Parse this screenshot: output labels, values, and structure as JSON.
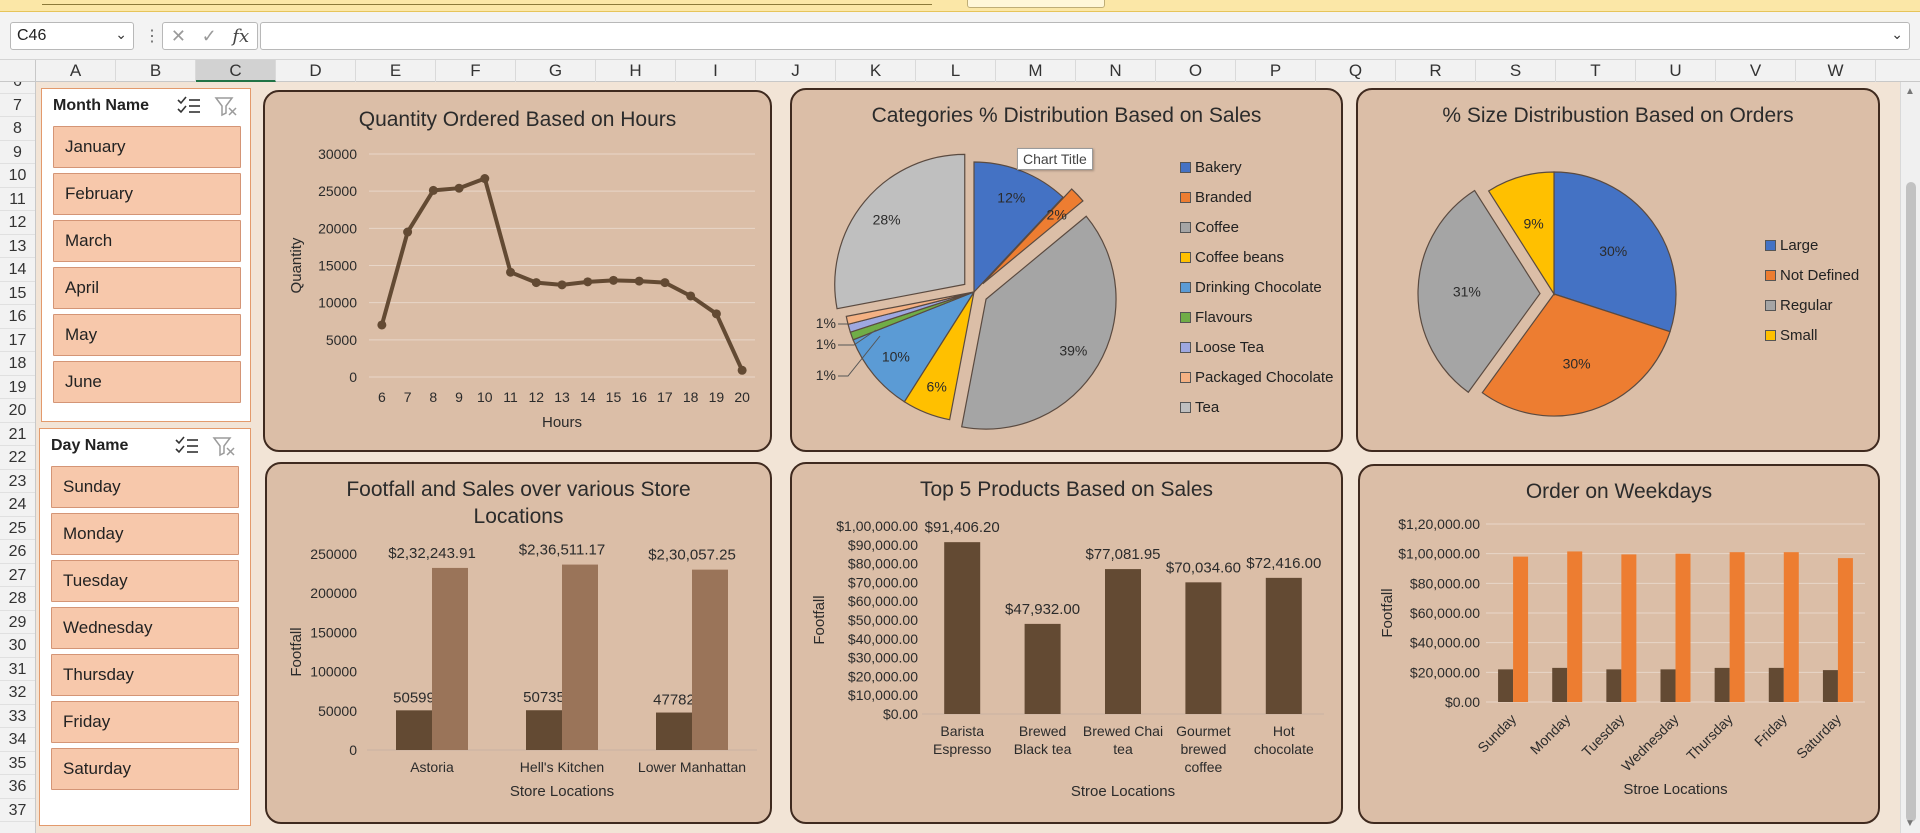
{
  "formula_bar": {
    "name_box": "C46",
    "dots": "⋮",
    "cancel": "✕",
    "enter": "✓",
    "fx": "fx",
    "content": ""
  },
  "columns": [
    "A",
    "B",
    "C",
    "D",
    "E",
    "F",
    "G",
    "H",
    "I",
    "J",
    "K",
    "L",
    "M",
    "N",
    "O",
    "P",
    "Q",
    "R",
    "S",
    "T",
    "U",
    "V",
    "W"
  ],
  "selected_column": "C",
  "rows": [
    "6",
    "7",
    "8",
    "9",
    "10",
    "11",
    "12",
    "13",
    "14",
    "15",
    "16",
    "17",
    "18",
    "19",
    "20",
    "21",
    "22",
    "23",
    "24",
    "25",
    "26",
    "27",
    "28",
    "29",
    "30",
    "31",
    "32",
    "33",
    "34",
    "35",
    "36",
    "37"
  ],
  "slicers": {
    "month": {
      "title": "Month Name",
      "items": [
        "January",
        "February",
        "March",
        "April",
        "May",
        "June"
      ]
    },
    "day": {
      "title": "Day Name",
      "items": [
        "Sunday",
        "Monday",
        "Tuesday",
        "Wednesday",
        "Thursday",
        "Friday",
        "Saturday"
      ]
    }
  },
  "colors": {
    "panel_bg": "#dbbea7",
    "panel_border": "#3f2a1f",
    "sheet_bg": "#f2e4d6",
    "slicer_item": "#f7c8ab",
    "dark_brown": "#634a33",
    "light_brown": "#9a7459",
    "orange": "#ed7d31"
  },
  "charts": {
    "hours": {
      "title": "Quantity Ordered Based on Hours",
      "chart_data": {
        "type": "line",
        "title": "Quantity Ordered Based on Hours",
        "xlabel": "Hours",
        "ylabel": "Quantity",
        "x": [
          "6",
          "7",
          "8",
          "9",
          "10",
          "11",
          "12",
          "13",
          "14",
          "15",
          "16",
          "17",
          "18",
          "19",
          "20"
        ],
        "values": [
          7000,
          19500,
          25100,
          25400,
          26700,
          14100,
          12700,
          12400,
          12800,
          13000,
          12900,
          12700,
          10900,
          8500,
          900
        ],
        "yticks": [
          "0",
          "5000",
          "10000",
          "15000",
          "20000",
          "25000",
          "30000"
        ],
        "ylim": [
          0,
          30000
        ],
        "grid": true
      }
    },
    "categories": {
      "title": "Categories % Distribution Based on Sales",
      "tooltip": "Chart Title",
      "chart_data": {
        "type": "pie",
        "title": "Categories % Distribution Based on Sales",
        "categories": [
          "Bakery",
          "Branded",
          "Coffee",
          "Coffee beans",
          "Drinking Chocolate",
          "Flavours",
          "Loose Tea",
          "Packaged Chocolate",
          "Tea"
        ],
        "values": [
          12,
          2,
          39,
          6,
          10,
          1,
          1,
          1,
          28
        ],
        "labels": [
          "12%",
          "2%",
          "39%",
          "6%",
          "10%",
          "1%",
          "1%",
          "1%",
          "28%"
        ],
        "colors": [
          "#4472c4",
          "#ed7d31",
          "#a5a5a5",
          "#ffc000",
          "#5b9bd5",
          "#70ad47",
          "#9ea8e0",
          "#f4b183",
          "#bfbfbf"
        ],
        "legend": "right"
      }
    },
    "size": {
      "title": "% Size Distribustion Based on Orders",
      "chart_data": {
        "type": "pie",
        "title": "% Size Distribustion Based on Orders",
        "categories": [
          "Large",
          "Not Defined",
          "Regular",
          "Small"
        ],
        "values": [
          30,
          30,
          31,
          9
        ],
        "labels": [
          "30%",
          "30%",
          "31%",
          "9%"
        ],
        "colors": [
          "#4472c4",
          "#ed7d31",
          "#a5a5a5",
          "#ffc000"
        ],
        "legend": "right"
      }
    },
    "footfall": {
      "title": "Footfall and Sales over various Store Locations",
      "chart_data": {
        "type": "bar",
        "title": "Footfall and Sales over various Store Locations",
        "xlabel": "Store Locations",
        "ylabel": "Footfall",
        "categories": [
          "Astoria",
          "Hell's Kitchen",
          "Lower Manhattan"
        ],
        "series": [
          {
            "values": [
              50599,
              50735,
              47782
            ],
            "labels": [
              "50599",
              "50735",
              "47782"
            ],
            "color": "#634a33"
          },
          {
            "values": [
              232243.91,
              236511.17,
              230057.25
            ],
            "labels": [
              "$2,32,243.91",
              "$2,36,511.17",
              "$2,30,057.25"
            ],
            "color": "#9a7459"
          }
        ],
        "yticks": [
          "0",
          "50000",
          "100000",
          "150000",
          "200000",
          "250000"
        ],
        "ylim": [
          0,
          250000
        ]
      }
    },
    "top5": {
      "title": "Top 5 Products Based on Sales",
      "chart_data": {
        "type": "bar",
        "title": "Top 5 Products Based on Sales",
        "xlabel": "Stroe Locations",
        "ylabel": "Footfall",
        "categories": [
          "Barista Espresso",
          "Brewed Black tea",
          "Brewed Chai tea",
          "Gourmet brewed coffee",
          "Hot chocolate"
        ],
        "category_lines": [
          [
            "Barista",
            "Espresso"
          ],
          [
            "Brewed",
            "Black tea"
          ],
          [
            "Brewed Chai",
            "tea"
          ],
          [
            "Gourmet",
            "brewed",
            "coffee"
          ],
          [
            "Hot",
            "chocolate"
          ]
        ],
        "values": [
          91406.2,
          47932.0,
          77081.95,
          70034.6,
          72416.0
        ],
        "labels": [
          "$91,406.20",
          "$47,932.00",
          "$77,081.95",
          "$70,034.60",
          "$72,416.00"
        ],
        "yticks": [
          "$0.00",
          "$10,000.00",
          "$20,000.00",
          "$30,000.00",
          "$40,000.00",
          "$50,000.00",
          "$60,000.00",
          "$70,000.00",
          "$80,000.00",
          "$90,000.00",
          "$1,00,000.00"
        ],
        "ylim": [
          0,
          100000
        ]
      }
    },
    "weekdays": {
      "title": "Order on Weekdays",
      "chart_data": {
        "type": "bar",
        "title": "Order on Weekdays",
        "xlabel": "Stroe Locations",
        "ylabel": "Footfall",
        "categories": [
          "Sunday",
          "Monday",
          "Tuesday",
          "Wednesday",
          "Thursday",
          "Friday",
          "Saturday"
        ],
        "series": [
          {
            "values": [
              22000,
              23000,
              22000,
              22000,
              23000,
              23000,
              21500
            ],
            "color": "#634a33"
          },
          {
            "values": [
              98000,
              101500,
              99500,
              100000,
              101000,
              101000,
              97000
            ],
            "color": "#ed7d31"
          }
        ],
        "yticks": [
          "$0.00",
          "$20,000.00",
          "$40,000.00",
          "$60,000.00",
          "$80,000.00",
          "$1,00,000.00",
          "$1,20,000.00"
        ],
        "ylim": [
          0,
          120000
        ],
        "grid": true
      }
    }
  }
}
